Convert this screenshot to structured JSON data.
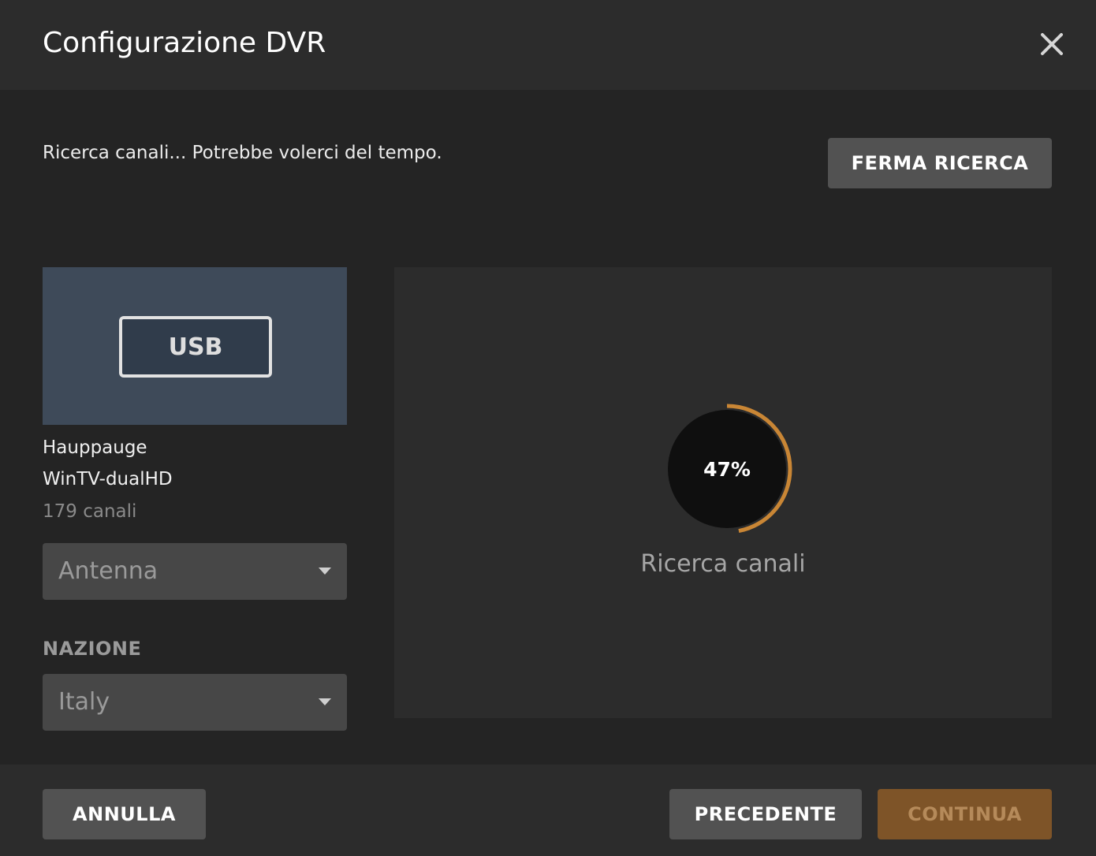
{
  "header": {
    "title": "Configurazione DVR",
    "close_icon": "close-icon"
  },
  "status": {
    "text": "Ricerca canali... Potrebbe volerci del tempo.",
    "stop_label": "FERMA RICERCA"
  },
  "device": {
    "badge": "USB",
    "brand": "Hauppauge",
    "model": "WinTV-dualHD",
    "channels": "179 canali",
    "source_value": "Antenna",
    "country_label": "NAZIONE",
    "country_value": "Italy"
  },
  "scan": {
    "progress_fraction": 0.47,
    "progress_text": "47%",
    "label": "Ricerca canali"
  },
  "footer": {
    "cancel_label": "ANNULLA",
    "prev_label": "PRECEDENTE",
    "continue_label": "CONTINUA"
  },
  "colors": {
    "background": "#242424",
    "panel": "#2c2c2c",
    "accent": "#c98635",
    "button": "#525252",
    "continue_button": "#7e5428"
  }
}
